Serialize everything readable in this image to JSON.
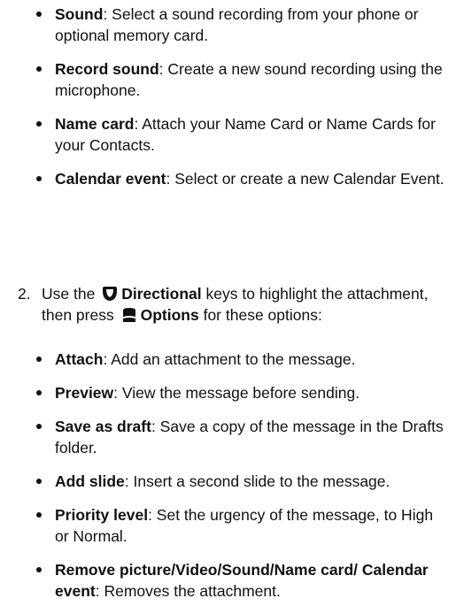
{
  "list1": [
    {
      "term": "Sound",
      "desc": ": Select a sound recording from your phone or optional memory card."
    },
    {
      "term": "Record sound",
      "desc": ": Create a new sound recording using the microphone."
    },
    {
      "term": "Name card",
      "desc": ": Attach your Name Card or Name Cards for your Contacts."
    },
    {
      "term": "Calendar event",
      "desc": ": Select or create a new Calendar Event."
    }
  ],
  "step": {
    "number": "2.",
    "t1": "Use the",
    "directional": "Directional",
    "t2": "keys to highlight the attachment, then press",
    "options": "Options",
    "t3": "for these options:"
  },
  "list2": [
    {
      "term": "Attach",
      "desc": ": Add an attachment to the message."
    },
    {
      "term": "Preview",
      "desc": ": View the message before sending."
    },
    {
      "term": "Save as draft",
      "desc": ": Save a copy of the message in the Drafts folder."
    },
    {
      "term": "Add slide",
      "desc": ": Insert a second slide to the message."
    },
    {
      "term": "Priority level",
      "desc": ": Set the urgency of the message, to High or Normal."
    },
    {
      "term": "Remove picture/Video/Sound/Name card/ Calendar event",
      "desc": ": Removes the attachment."
    }
  ]
}
